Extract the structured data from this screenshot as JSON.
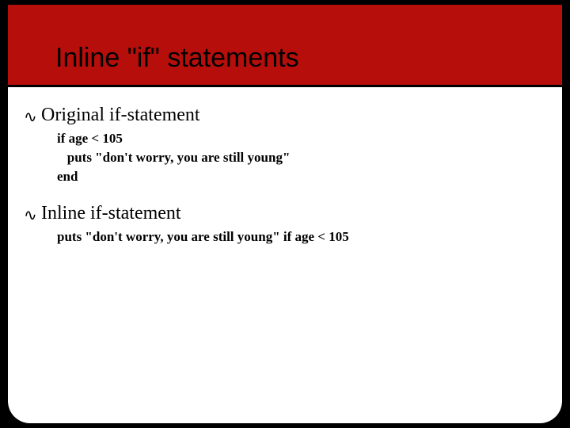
{
  "slide": {
    "title": "Inline \"if\" statements",
    "bullet_glyph": "་",
    "sections": [
      {
        "heading": "Original if-statement",
        "code": "if age < 105\n   puts \"don't worry, you are still young\"\nend"
      },
      {
        "heading": "Inline if-statement",
        "code": "puts \"don't worry, you are still young\" if age < 105"
      }
    ]
  }
}
